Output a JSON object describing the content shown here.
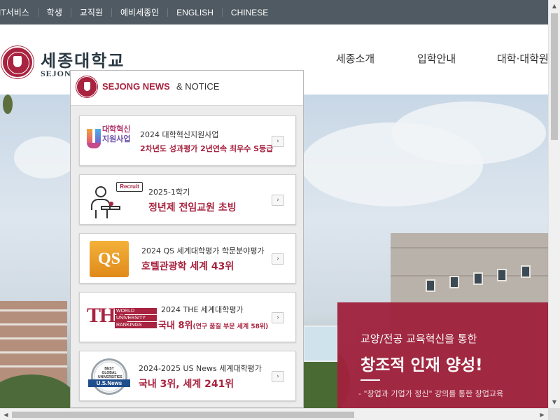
{
  "topbar": {
    "items": [
      "IT서비스",
      "학생",
      "교직원",
      "예비세종인",
      "ENGLISH",
      "CHINESE"
    ]
  },
  "header": {
    "logo_ko": "세종대학교",
    "logo_en": "SEJONG",
    "nav": [
      "세종소개",
      "입학안내",
      "대학·대학원"
    ]
  },
  "popup": {
    "title_brand": "SEJONG NEWS",
    "title_rest": "& NOTICE",
    "cards": [
      {
        "icon": "innovation-logo",
        "icon_text1": "대학혁신",
        "icon_text2": "지원사업",
        "line1": "2024 대학혁신지원사업",
        "line2": "2차년도 성과평가 2년연속 최우수 S등급",
        "line2_color": "#a8233f"
      },
      {
        "icon": "recruit-icon",
        "icon_text1": "Recruit",
        "line1": "2025-1학기",
        "line2": "정년제 전임교원 초빙",
        "line2_color": "#a8233f"
      },
      {
        "icon": "qs-logo",
        "icon_text1": "QS",
        "line1": "2024 QS 세계대학평가 학문분야평가",
        "line2": "호텔관광학 세계 43위",
        "line2_color": "#a8233f"
      },
      {
        "icon": "the-logo",
        "icon_text1": "THE",
        "icon_text2": [
          "WORLD",
          "UNIVERSITY",
          "RANKINGS"
        ],
        "line1": "2024 THE 세계대학평가",
        "line2": "국내 8위",
        "line2_small": "(연구 품질 부문 세계 58위)",
        "line2_color": "#a8233f"
      },
      {
        "icon": "usnews-badge",
        "icon_text1": "BEST GLOBAL UNIVERSITIES",
        "icon_text2": "U.S.News",
        "line1": "2024-2025 US News 세계대학평가",
        "line2": "국내 3위, 세계 241위",
        "line2_color": "#a8233f"
      }
    ],
    "go_glyph": "›"
  },
  "promo": {
    "line1": "교양/전공 교육혁신을 통한",
    "line2": "창조적 인재 양성!",
    "line3": "- \"창업과 기업가 정신\" 강의를 통한 창업교육"
  },
  "colors": {
    "topbar_bg": "#4f5a62",
    "brand_red": "#a8233f",
    "promo_bg": "#a0213c"
  },
  "scroll": {
    "up": "▲",
    "down": "▼",
    "left": "◀",
    "right": "▶"
  }
}
